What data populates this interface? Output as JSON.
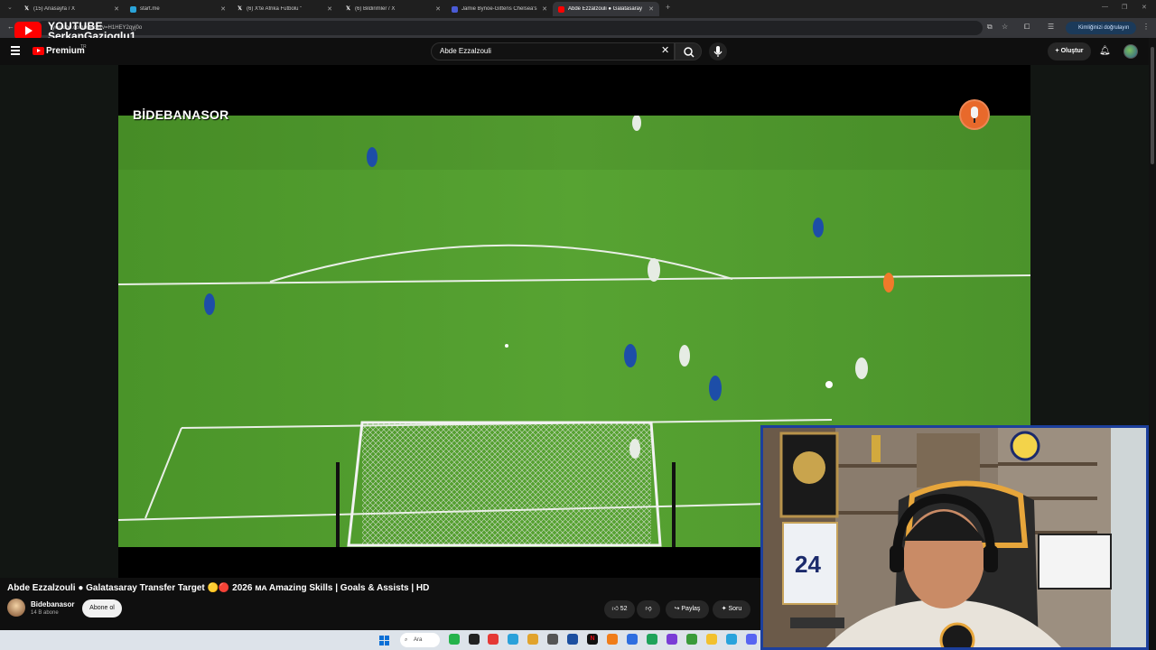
{
  "browser": {
    "tabs": [
      {
        "title": "(15) Anasayfa / X",
        "favicon": "x-icon",
        "active": false
      },
      {
        "title": "start.me",
        "favicon": "startme-icon",
        "active": false
      },
      {
        "title": "(6) X'te Afrika Futbolu \"",
        "favicon": "x-icon",
        "active": false
      },
      {
        "title": "(6) Bildirimler / X",
        "favicon": "x-icon",
        "active": false
      },
      {
        "title": "Jamie Bynoe-Gittens Chelsea's",
        "favicon": "tf-icon",
        "active": false
      },
      {
        "title": "Abde Ezzalzouli ● Galatasaray",
        "favicon": "youtube-icon",
        "active": true
      }
    ],
    "url": "youtube.com/watch?v=H1HEY2qyj0o",
    "verify_label": "Kimliğinizi doğrulayın"
  },
  "overlay": {
    "youtube_label": "YOUTUBE",
    "channel_label": "SerkanGazioglu1"
  },
  "youtube": {
    "premium_label": "Premium",
    "premium_region": "TR",
    "search_value": "Abde Ezzalzouli",
    "create_label": "Oluştur"
  },
  "video": {
    "watermark": "BİDEBANASOR",
    "title": "Abde Ezzalzouli ● Galatasaray Transfer Target 🟡🔴 2026 ᴍᴀ Amazing Skills | Goals & Assists | HD",
    "channel_name": "Bidebanasor",
    "subscribers": "14 B abone",
    "subscribe_label": "Abone ol",
    "likes": "52",
    "share_label": "Paylaş",
    "ask_label": "Soru"
  },
  "taskbar": {
    "search_label": "Ara"
  },
  "colors": {
    "pitch_green": "#4f9a2e",
    "youtube_red": "#ff0000",
    "webcam_border": "#1c3f9c",
    "chelsea_blue": "#1d4ea8"
  }
}
